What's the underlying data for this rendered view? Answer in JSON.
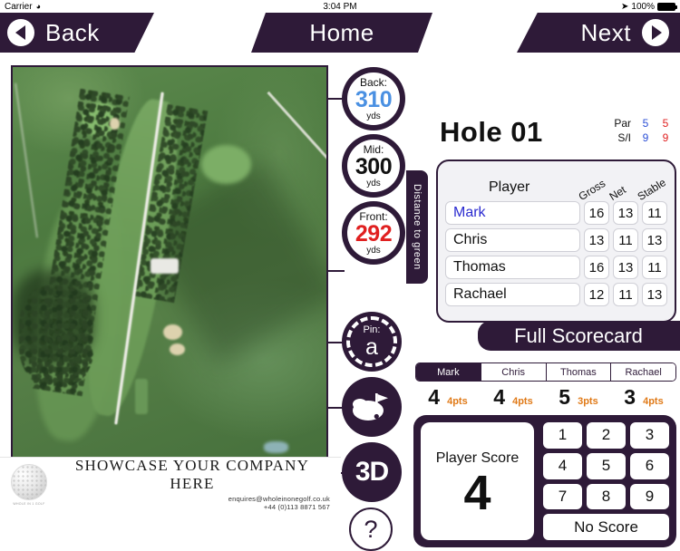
{
  "status_bar": {
    "carrier": "Carrier",
    "wifi_icon": "wifi-icon",
    "time": "3:04 PM",
    "location_icon": "location-arrow-icon",
    "battery_percent": "100%"
  },
  "navbar": {
    "back_label": "Back",
    "home_label": "Home",
    "next_label": "Next",
    "back_icon": "chevron-left-circle-icon",
    "next_icon": "chevron-right-circle-icon"
  },
  "distances": {
    "side_label": "Distance to green",
    "units": "yds",
    "items": [
      {
        "label": "Back:",
        "value": "310",
        "units": "yds",
        "color": "#4a90e2"
      },
      {
        "label": "Mid:",
        "value": "300",
        "units": "yds",
        "color": "#111111"
      },
      {
        "label": "Front:",
        "value": "292",
        "units": "yds",
        "color": "#e02020"
      }
    ]
  },
  "pin": {
    "label": "Pin:",
    "position": "a"
  },
  "tools": {
    "green_view_icon": "green-flag-icon",
    "three_d_label": "3D",
    "help_label": "?"
  },
  "hole": {
    "title": "Hole 01",
    "par_label": "Par",
    "si_label": "S/I",
    "par_blue": "5",
    "par_red": "5",
    "si_blue": "9",
    "si_red": "9"
  },
  "scorecard": {
    "player_header": "Player",
    "columns": [
      "Gross",
      "Net",
      "Stable"
    ],
    "rows": [
      {
        "name": "Mark",
        "gross": "16",
        "net": "13",
        "stable": "11",
        "active": true
      },
      {
        "name": "Chris",
        "gross": "13",
        "net": "11",
        "stable": "13",
        "active": false
      },
      {
        "name": "Thomas",
        "gross": "16",
        "net": "13",
        "stable": "11",
        "active": false
      },
      {
        "name": "Rachael",
        "gross": "12",
        "net": "11",
        "stable": "13",
        "active": false
      }
    ],
    "full_scorecard_label": "Full Scorecard"
  },
  "player_tabs": {
    "tabs": [
      {
        "label": "Mark",
        "selected": true
      },
      {
        "label": "Chris",
        "selected": false
      },
      {
        "label": "Thomas",
        "selected": false
      },
      {
        "label": "Rachael",
        "selected": false
      }
    ],
    "scores": [
      {
        "score": "4",
        "points": "4pts"
      },
      {
        "score": "4",
        "points": "4pts"
      },
      {
        "score": "5",
        "points": "3pts"
      },
      {
        "score": "3",
        "points": "4pts"
      }
    ]
  },
  "keypad": {
    "player_score_label": "Player Score",
    "player_score_value": "4",
    "keys": [
      "1",
      "2",
      "3",
      "4",
      "5",
      "6",
      "7",
      "8",
      "9"
    ],
    "no_score_label": "No Score"
  },
  "advert": {
    "title": "SHOWCASE YOUR COMPANY HERE",
    "email": "enquires@wholeinonegolf.co.uk",
    "phone": "+44 (0)113 8871 567",
    "logo_caption": "WHOLE IN 1 GOLF"
  },
  "colors": {
    "brand_purple": "#2e1a38",
    "accent_orange": "#e07a18",
    "value_blue": "#4a90e2",
    "value_red": "#e02020"
  }
}
